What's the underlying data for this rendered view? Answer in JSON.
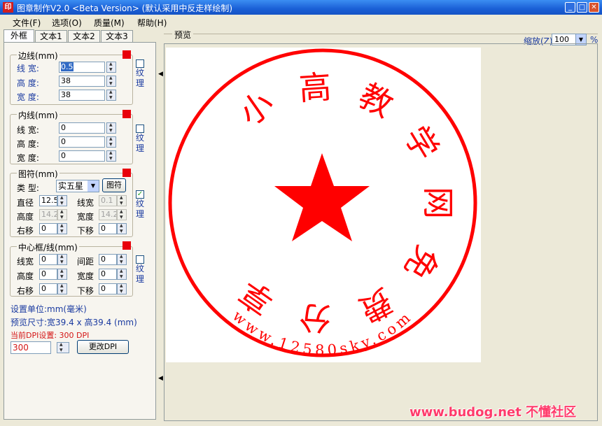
{
  "window": {
    "title": "图章制作V2.0 <Beta Version> (默认采用中反走样绘制)",
    "app_icon": "印",
    "min": "_",
    "max": "□",
    "close": "✕"
  },
  "menu": {
    "items": [
      "文件(F)",
      "选项(O)",
      "质量(M)",
      "帮助(H)"
    ]
  },
  "tabs": [
    "外框",
    "文本1",
    "文本2",
    "文本3"
  ],
  "border_group": {
    "title": "边线(mm)",
    "line_width_label": "线  宽:",
    "line_width": "0.5",
    "height_label": "高  度:",
    "height": "38",
    "width_label": "宽  度:",
    "width": "38",
    "texture_label": "纹理"
  },
  "inner_group": {
    "title": "内线(mm)",
    "line_width_label": "线  宽:",
    "line_width": "0",
    "height_label": "高  度:",
    "height": "0",
    "width_label": "宽  度:",
    "width": "0",
    "texture_label": "纹理"
  },
  "symbol_group": {
    "title": "图符(mm)",
    "type_label": "类  型:",
    "type_value": "实五星",
    "symbol_button": "图符",
    "diameter_label": "直径",
    "diameter": "12.5",
    "line_width_label": "线宽",
    "line_width": "0.1",
    "height_label": "高度",
    "height": "14.2",
    "width_label": "宽度",
    "width": "14.2",
    "right_label": "右移",
    "right": "0",
    "down_label": "下移",
    "down": "0",
    "texture_label": "纹理",
    "texture_checked": "✓"
  },
  "center_group": {
    "title": "中心框/线(mm)",
    "line_width_label": "线宽",
    "line_width": "0",
    "spacing_label": "间距",
    "spacing": "0",
    "height_label": "高度",
    "height": "0",
    "width_label": "宽度",
    "width": "0",
    "right_label": "右移",
    "right": "0",
    "down_label": "下移",
    "down": "0",
    "texture_label": "纹理"
  },
  "status": {
    "unit": "设置单位:mm(毫米)",
    "preview_size": "预览尺寸:宽39.4 x 高39.4 (mm)",
    "dpi_current": "当前DPI设置: 300 DPI",
    "dpi_value": "300",
    "change_dpi_button": "更改DPI"
  },
  "preview": {
    "label": "预览",
    "zoom_label": "缩放(Z)",
    "zoom_value": "100",
    "zoom_unit": "%"
  },
  "stamp": {
    "main_chars": [
      "小",
      "高",
      "教",
      "学",
      "网",
      "免",
      "费",
      "分",
      "享"
    ],
    "url_text": "www.12580sky.com",
    "color": "#ff0000"
  },
  "watermark": "www.budog.net 不懂社区",
  "colors": {
    "accent_red": "#e8000b"
  }
}
